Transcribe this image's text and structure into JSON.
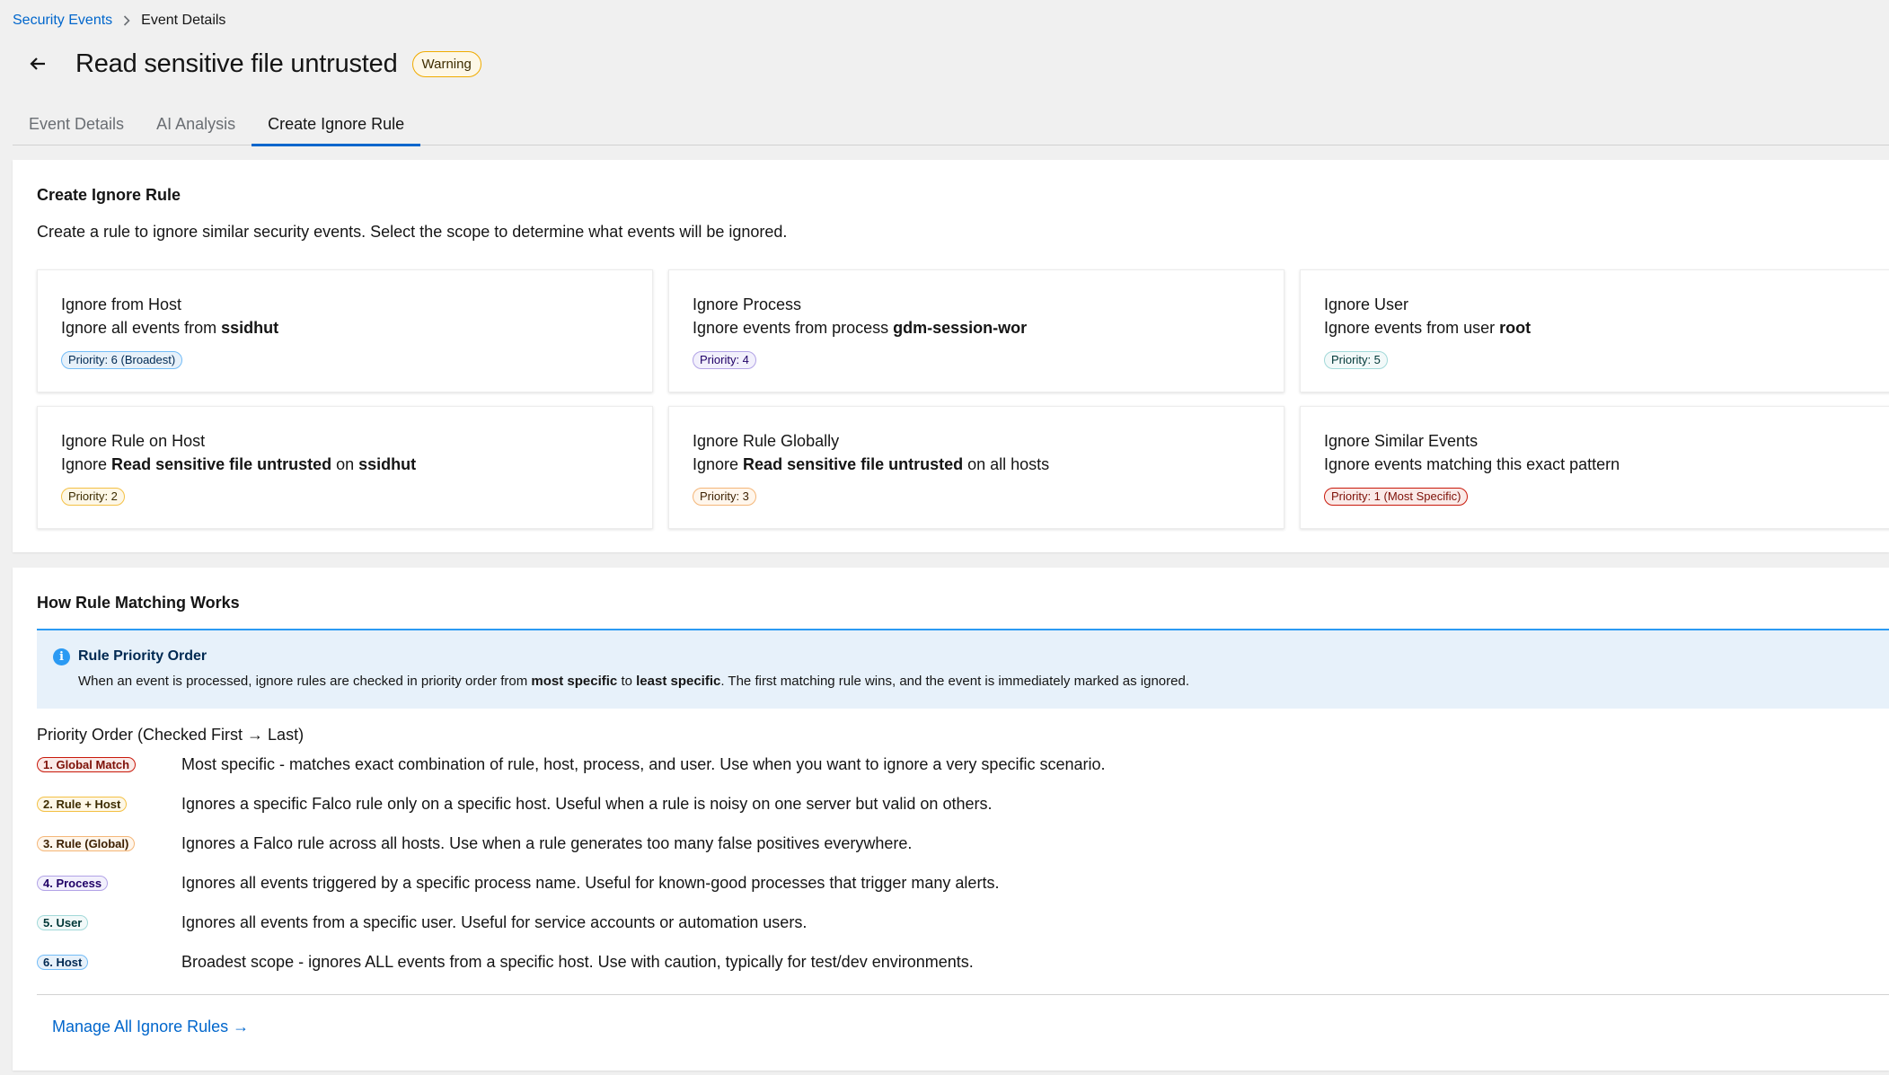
{
  "breadcrumb": {
    "root": "Security Events",
    "current": "Event Details"
  },
  "header": {
    "title": "Read sensitive file untrusted",
    "badge": "Warning"
  },
  "tabs": [
    {
      "label": "Event Details",
      "active": false
    },
    {
      "label": "AI Analysis",
      "active": false
    },
    {
      "label": "Create Ignore Rule",
      "active": true
    }
  ],
  "create": {
    "title": "Create Ignore Rule",
    "description": "Create a rule to ignore similar security events. Select the scope to determine what events will be ignored.",
    "cards": [
      {
        "title": "Ignore from Host",
        "desc_pre": "Ignore all events from ",
        "desc_b1": "ssidhut",
        "desc_mid": "",
        "desc_b2": "",
        "desc_post": "",
        "badge": "Priority: 6 (Broadest)",
        "color": "blue"
      },
      {
        "title": "Ignore Process",
        "desc_pre": "Ignore events from process ",
        "desc_b1": "gdm-session-wor",
        "desc_mid": "",
        "desc_b2": "",
        "desc_post": "",
        "badge": "Priority: 4",
        "color": "purple"
      },
      {
        "title": "Ignore User",
        "desc_pre": "Ignore events from user ",
        "desc_b1": "root",
        "desc_mid": "",
        "desc_b2": "",
        "desc_post": "",
        "badge": "Priority: 5",
        "color": "cyan"
      },
      {
        "title": "Ignore Rule on Host",
        "desc_pre": "Ignore ",
        "desc_b1": "Read sensitive file untrusted",
        "desc_mid": " on ",
        "desc_b2": "ssidhut",
        "desc_post": "",
        "badge": "Priority: 2",
        "color": "gold"
      },
      {
        "title": "Ignore Rule Globally",
        "desc_pre": "Ignore ",
        "desc_b1": "Read sensitive file untrusted",
        "desc_mid": " on all hosts",
        "desc_b2": "",
        "desc_post": "",
        "badge": "Priority: 3",
        "color": "orange"
      },
      {
        "title": "Ignore Similar Events",
        "desc_pre": "Ignore events matching this exact pattern",
        "desc_b1": "",
        "desc_mid": "",
        "desc_b2": "",
        "desc_post": "",
        "badge": "Priority: 1 (Most Specific)",
        "color": "red"
      }
    ]
  },
  "matching": {
    "title": "How Rule Matching Works",
    "alert": {
      "title": "Rule Priority Order",
      "body_pre": "When an event is processed, ignore rules are checked in priority order from ",
      "body_b1": "most specific",
      "body_mid": " to ",
      "body_b2": "least specific",
      "body_post": ". The first matching rule wins, and the event is immediately marked as ignored."
    },
    "order_heading": "Priority Order (Checked First → Last)",
    "order": [
      {
        "badge": "1. Global Match",
        "color": "red",
        "text": "Most specific - matches exact combination of rule, host, process, and user. Use when you want to ignore a very specific scenario."
      },
      {
        "badge": "2. Rule + Host",
        "color": "gold",
        "text": "Ignores a specific Falco rule only on a specific host. Useful when a rule is noisy on one server but valid on others."
      },
      {
        "badge": "3. Rule (Global)",
        "color": "orange",
        "text": "Ignores a Falco rule across all hosts. Use when a rule generates too many false positives everywhere."
      },
      {
        "badge": "4. Process",
        "color": "purple",
        "text": "Ignores all events triggered by a specific process name. Useful for known-good processes that trigger many alerts."
      },
      {
        "badge": "5. User",
        "color": "cyan",
        "text": "Ignores all events from a specific user. Useful for service accounts or automation users."
      },
      {
        "badge": "6. Host",
        "color": "blue",
        "text": "Broadest scope - ignores ALL events from a specific host. Use with caution, typically for test/dev environments."
      }
    ],
    "manage_link": "Manage All Ignore Rules →"
  }
}
